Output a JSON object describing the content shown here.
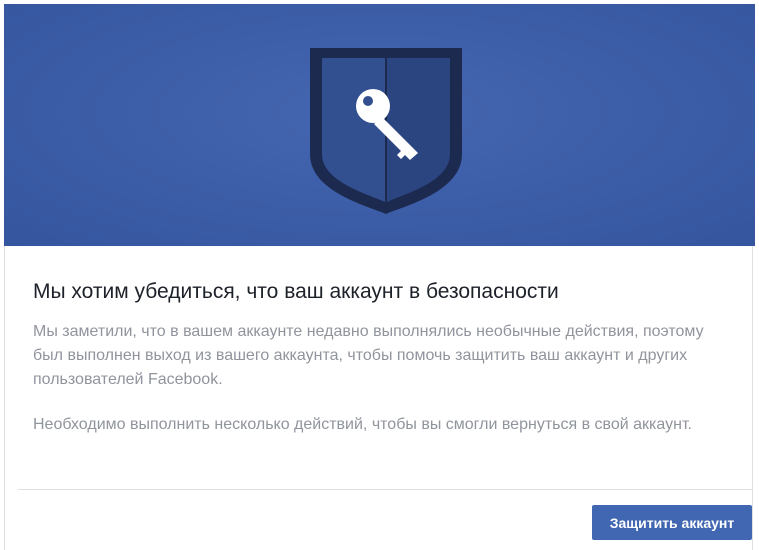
{
  "hero": {
    "illustration": "shield-key-icon",
    "background_color": "#3b5998"
  },
  "dialog": {
    "title": "Мы хотим убедиться, что ваш аккаунт в безопасности",
    "paragraph_1": "Мы заметили, что в вашем аккаунте недавно выполнялись необычные действия, поэтому был выполнен выход из вашего аккаунта, чтобы помочь защитить ваш аккаунт и других пользователей Facebook.",
    "paragraph_2": "Необходимо выполнить несколько действий, чтобы вы смогли вернуться в свой аккаунт."
  },
  "footer": {
    "primary_button_label": "Защитить аккаунт",
    "primary_button_color": "#4267b2"
  }
}
